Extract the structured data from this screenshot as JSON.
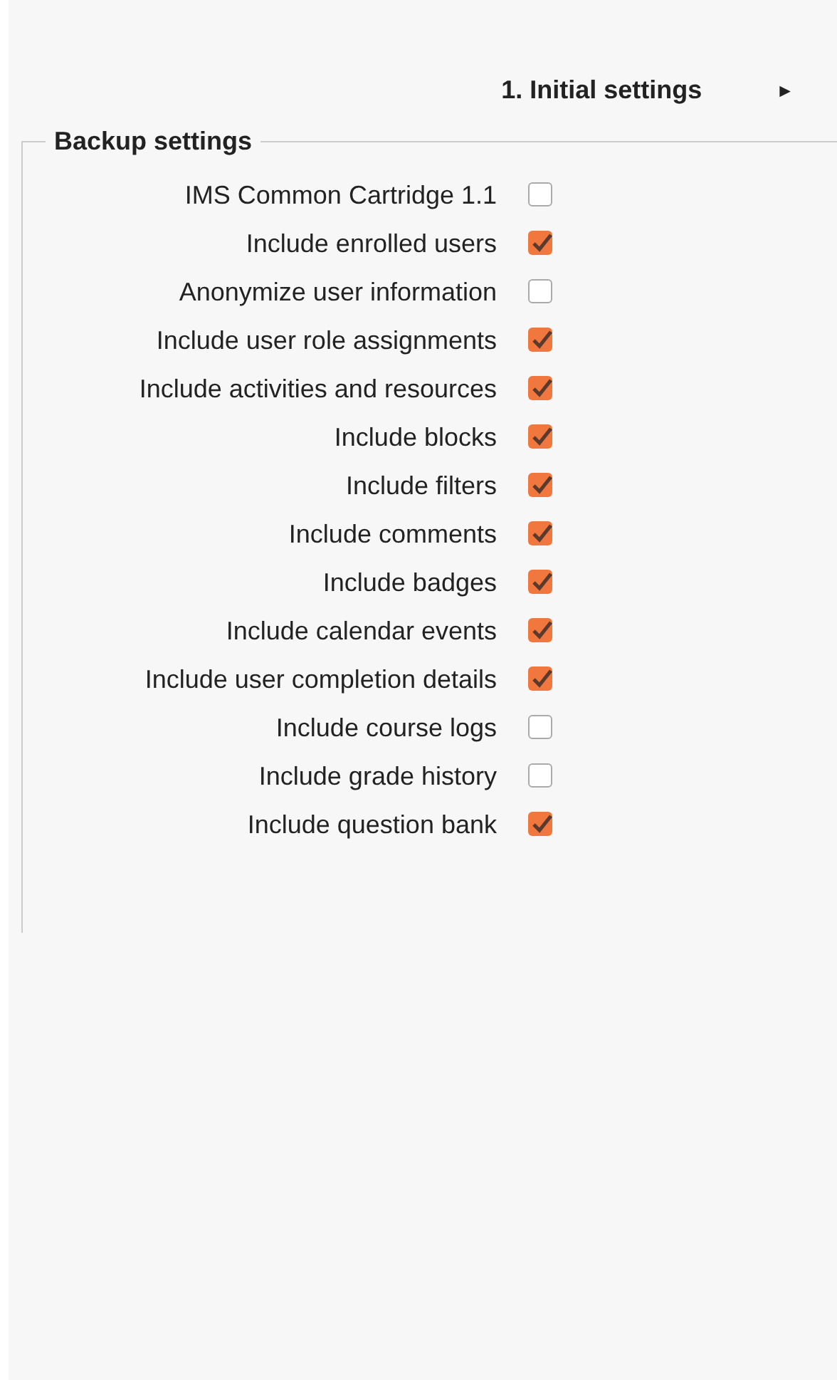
{
  "section": {
    "title": "1. Initial settings",
    "arrow": "►"
  },
  "fieldset": {
    "legend": "Backup settings",
    "settings": [
      {
        "label": "IMS Common Cartridge 1.1",
        "checked": false
      },
      {
        "label": "Include enrolled users",
        "checked": true
      },
      {
        "label": "Anonymize user information",
        "checked": false
      },
      {
        "label": "Include user role assignments",
        "checked": true
      },
      {
        "label": "Include activities and resources",
        "checked": true
      },
      {
        "label": "Include blocks",
        "checked": true
      },
      {
        "label": "Include filters",
        "checked": true
      },
      {
        "label": "Include comments",
        "checked": true
      },
      {
        "label": "Include badges",
        "checked": true
      },
      {
        "label": "Include calendar events",
        "checked": true
      },
      {
        "label": "Include user completion details",
        "checked": true
      },
      {
        "label": "Include course logs",
        "checked": false
      },
      {
        "label": "Include grade history",
        "checked": false
      },
      {
        "label": "Include question bank",
        "checked": true
      }
    ]
  }
}
